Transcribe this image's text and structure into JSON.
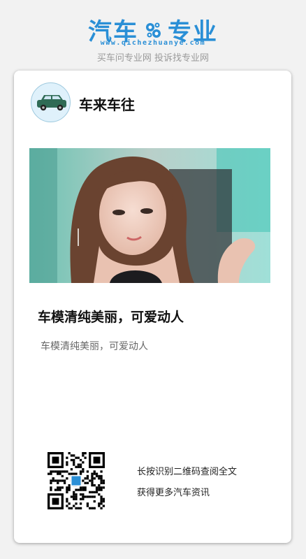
{
  "brand": {
    "name_left": "汽车",
    "name_right": "专业",
    "url": "www.qichezhuanye.com",
    "tagline": "买车问专业网 投诉找专业网",
    "color": "#2a8fd6",
    "logo_icon": "gear-icon"
  },
  "post": {
    "author": "车来车往",
    "avatar_icon": "car-icon",
    "headline": "车模清纯美丽，可爱动人",
    "summary": "车模清纯美丽，可爱动人"
  },
  "footer": {
    "qr_icon": "qr-code-icon",
    "line1": "长按识别二维码查阅全文",
    "line2": "获得更多汽车资讯"
  }
}
